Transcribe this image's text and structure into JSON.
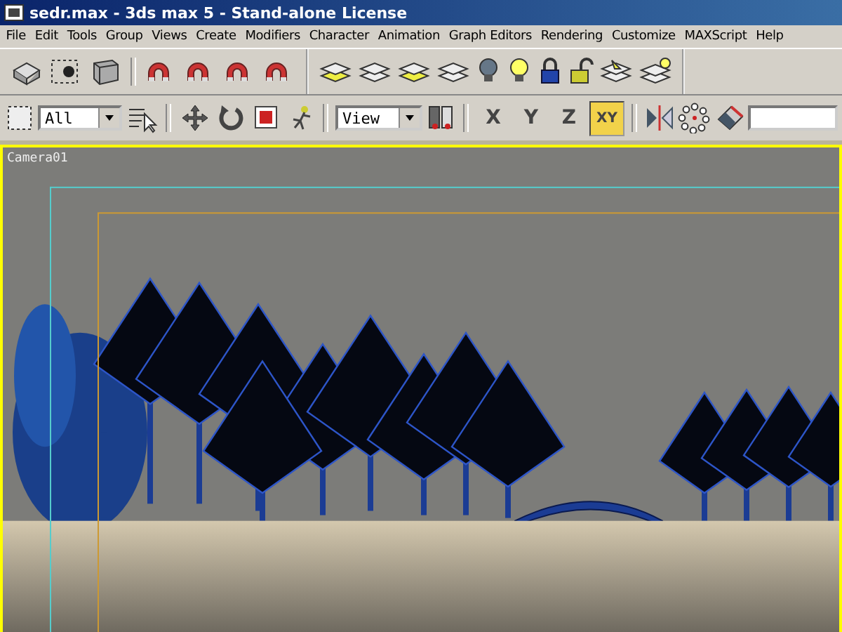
{
  "window": {
    "title": "sedr.max - 3ds max 5 - Stand-alone License"
  },
  "menu": [
    "File",
    "Edit",
    "Tools",
    "Group",
    "Views",
    "Create",
    "Modifiers",
    "Character",
    "Animation",
    "Graph Editors",
    "Rendering",
    "Customize",
    "MAXScript",
    "Help"
  ],
  "toolbar": {
    "selection_filter": "All",
    "reference_coordinate": "View",
    "axis_buttons": [
      {
        "label": "X",
        "selected": false
      },
      {
        "label": "Y",
        "selected": false
      },
      {
        "label": "Z",
        "selected": false
      },
      {
        "label": "XY",
        "selected": true
      }
    ]
  },
  "viewport": {
    "label": "Camera01"
  }
}
